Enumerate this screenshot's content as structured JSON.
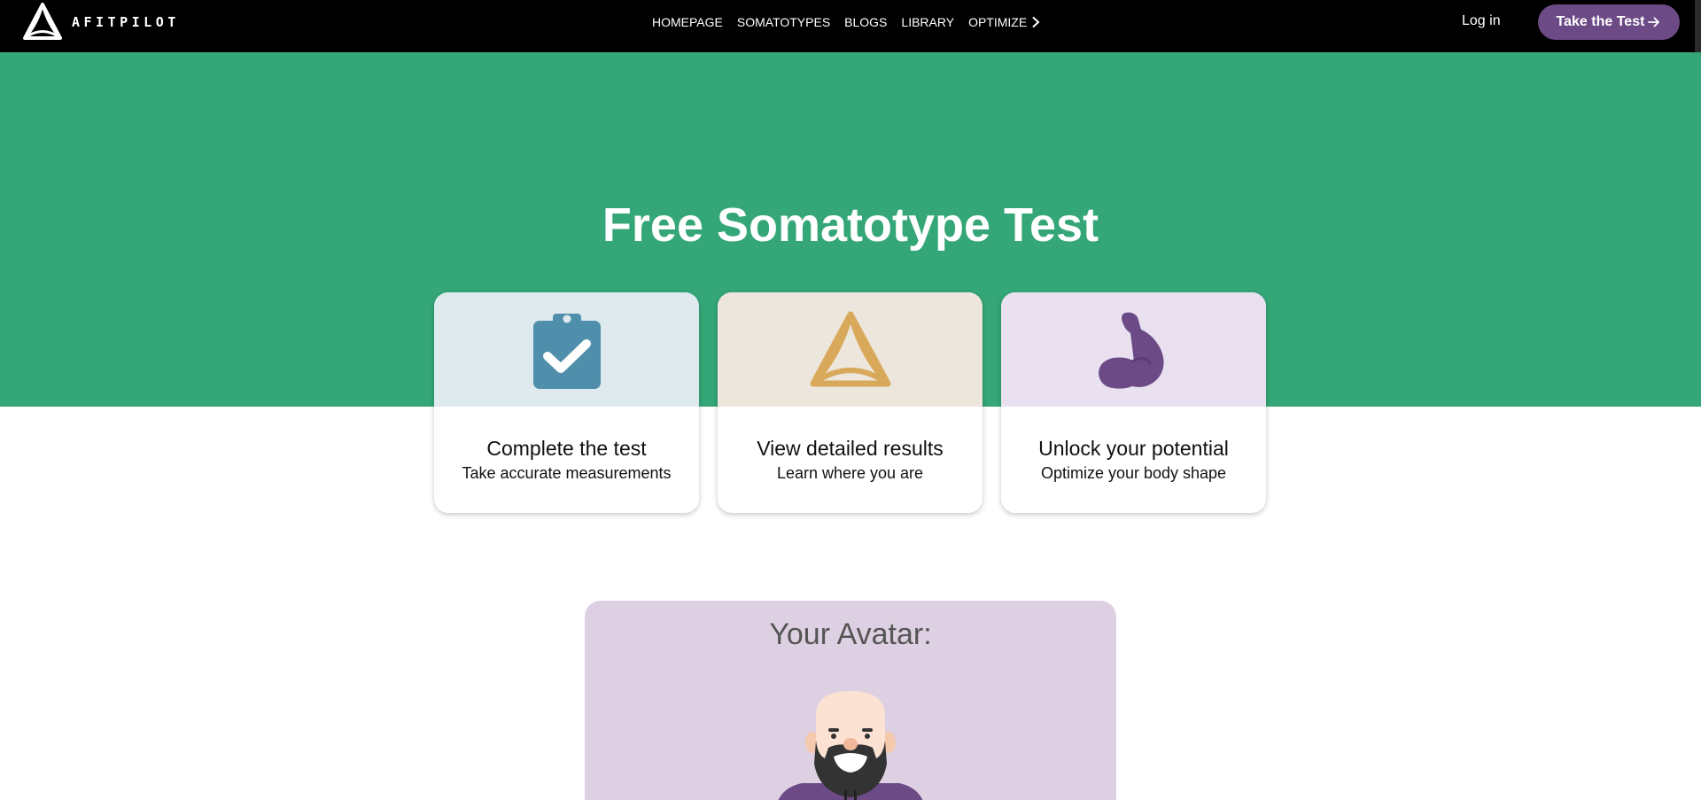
{
  "brand": {
    "name": "AFITPILOT",
    "logo_icon": "triquetra-logo-icon"
  },
  "nav": {
    "links": [
      "HOMEPAGE",
      "SOMATOTYPES",
      "BLOGS",
      "LIBRARY"
    ],
    "dropdown_label": "OPTIMIZE",
    "login_label": "Log in",
    "cta_label": "Take the Test"
  },
  "hero": {
    "title": "Free Somatotype Test",
    "background": "#34a677"
  },
  "cards": [
    {
      "title": "Complete the test",
      "subtitle": "Take accurate measurements",
      "icon": "clipboard-check-icon",
      "top_color": "#dfeaee",
      "icon_color": "#4f8fab"
    },
    {
      "title": "View detailed results",
      "subtitle": "Learn where you are",
      "icon": "triquetra-icon",
      "top_color": "#ece6dc",
      "icon_color": "#d9a95b"
    },
    {
      "title": "Unlock your potential",
      "subtitle": "Optimize your body shape",
      "icon": "flexed-bicep-icon",
      "top_color": "#e9e1f0",
      "icon_color": "#6c4a86"
    }
  ],
  "avatar": {
    "title": "Your Avatar:",
    "icon": "bearded-man-avatar-icon"
  },
  "colors": {
    "accent": "#6c4a86",
    "nav_bg": "#000000",
    "avatar_panel": "#ddd0e2"
  }
}
